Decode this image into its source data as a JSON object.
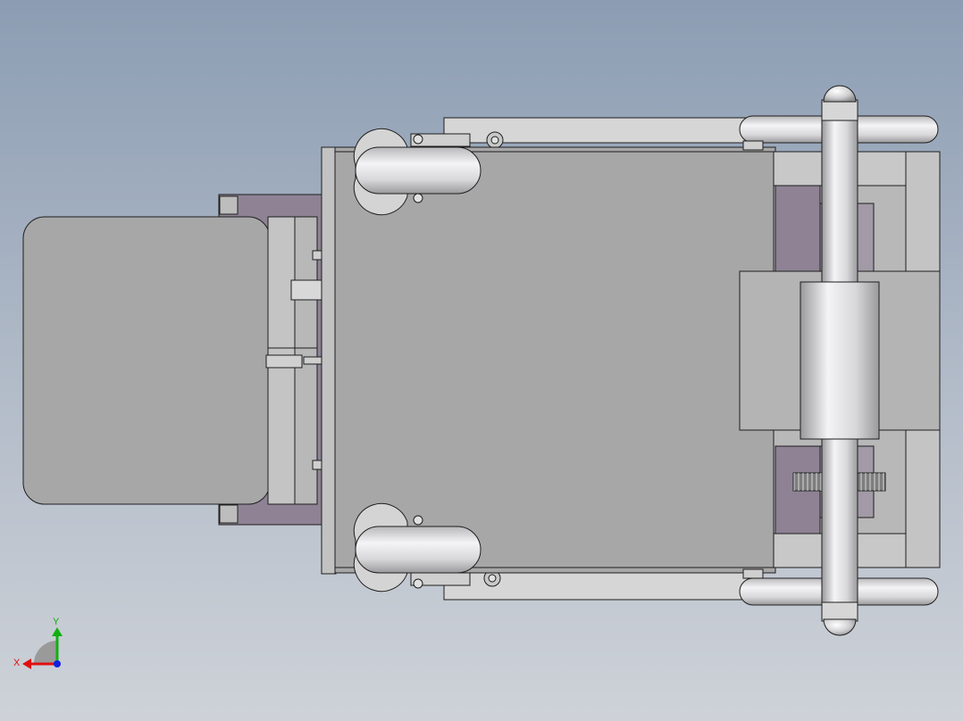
{
  "viewport": {
    "view": "top",
    "background_top": "#8c9db3",
    "background_bottom": "#ced2d8"
  },
  "model": {
    "colors": {
      "body": "#a7a7a7",
      "edge": "#1e1e1e",
      "frame": "#c9c9c9",
      "purple": "#8e8294",
      "light": "#dcdcdc",
      "chrome": "#e4e4e6"
    }
  },
  "triad": {
    "x_label": "X",
    "y_label": "Y",
    "x_color": "#e01010",
    "y_color": "#10b010",
    "z_color": "#1020e0"
  }
}
